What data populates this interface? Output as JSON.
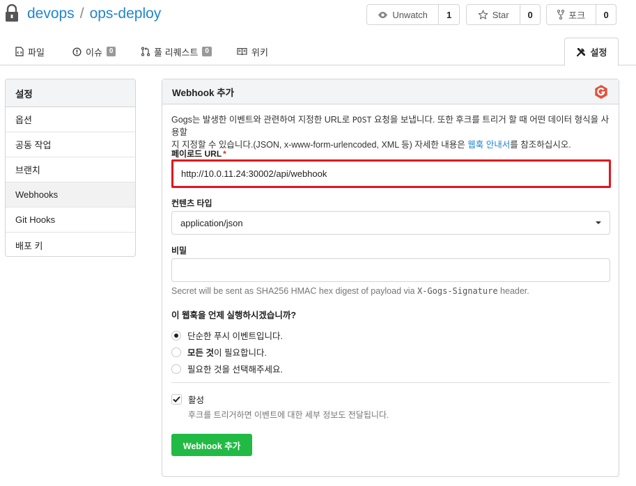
{
  "repo": {
    "owner": "devops",
    "separator": "/",
    "name": "ops-deploy"
  },
  "actions": {
    "watch": {
      "label": "Unwatch",
      "count": "1",
      "icon": "eye-icon"
    },
    "star": {
      "label": "Star",
      "count": "0",
      "icon": "star-icon"
    },
    "fork": {
      "label": "포크",
      "count": "0",
      "icon": "fork-icon"
    }
  },
  "tabs": [
    {
      "label": "파일",
      "icon": "file-code-icon"
    },
    {
      "label": "이슈",
      "badge": "0",
      "icon": "issue-icon"
    },
    {
      "label": "풀 리퀘스트",
      "badge": "0",
      "icon": "pull-request-icon"
    },
    {
      "label": "위키",
      "icon": "book-icon"
    },
    {
      "label": "설정",
      "icon": "tools-icon",
      "active": true
    }
  ],
  "sidebar": {
    "title": "설정",
    "items": [
      {
        "label": "옵션"
      },
      {
        "label": "공동 작업"
      },
      {
        "label": "브랜치"
      },
      {
        "label": "Webhooks",
        "active": true
      },
      {
        "label": "Git Hooks"
      },
      {
        "label": "배포 키"
      }
    ]
  },
  "form": {
    "title": "Webhook 추가",
    "description_part1": "Gogs는 발생한 이벤트와 관련하여 지정한 URL로 ",
    "description_post": "POST",
    "description_part2": " 요청을 보냅니다. 또한 후크를 트리거 할 때 어떤 데이터 형식을 사용할",
    "description_line2a": "지 지정할 수 있습니다.(JSON, x-www-form-urlencoded, XML 등) 자세한 내용은 ",
    "description_link": "웹훅 안내서",
    "description_line2b": "를 참조하십시오.",
    "payload_url_label": "페이로드 URL",
    "required_mark": "*",
    "payload_url_value": "http://10.0.11.24:30002/api/webhook",
    "content_type_label": "컨텐츠 타입",
    "content_type_value": "application/json",
    "secret_label": "비밀",
    "secret_value": "",
    "secret_help_prefix": "Secret will be sent as SHA256 HMAC hex digest of payload via ",
    "secret_help_header": "X-Gogs-Signature",
    "secret_help_suffix": " header.",
    "trigger_question": "이 웹훅을 언제 실행하시겠습니까?",
    "trigger_options": [
      {
        "label": "단순한 푸시 이벤트입니다.",
        "checked": true
      },
      {
        "bold": "모든 것",
        "label": "이 필요합니다.",
        "checked": false
      },
      {
        "label": "필요한 것을 선택해주세요.",
        "checked": false
      }
    ],
    "active_label": "활성",
    "active_checked": true,
    "active_help": "후크를 트리거하면 이벤트에 대한 세부 정보도 전달됩니다.",
    "submit_label": "Webhook 추가"
  },
  "colors": {
    "link": "#2185d0",
    "submit": "#21ba45",
    "highlight": "#e3141f",
    "gogs_logo": "#e2513c"
  }
}
